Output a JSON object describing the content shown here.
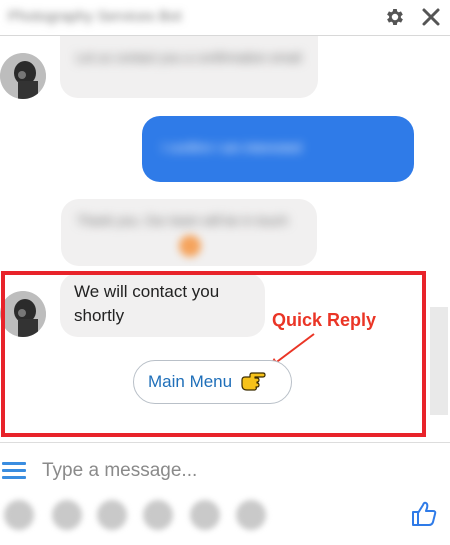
{
  "header": {
    "title": "Photography Services Bot",
    "settings_icon": "gear-icon",
    "close_icon": "close-icon"
  },
  "messages": {
    "bot_message_1": "Let us contact you a confirmation email",
    "user_message": "I confirm I am interested",
    "bot_message_2": "Thank you. Our team will be in touch",
    "bot_message_3": "We will contact you shortly"
  },
  "quick_reply": {
    "label": "Main Menu",
    "emoji_icon": "pointing-hand-icon"
  },
  "annotation": {
    "label": "Quick Reply",
    "color": "#ea3526"
  },
  "composer": {
    "placeholder": "Type a message...",
    "menu_icon": "menu-icon",
    "like_icon": "thumbs-up-icon"
  },
  "colors": {
    "accent": "#2f7be8",
    "bot_bubble": "#f1f0f0",
    "highlight_border": "#e8232a",
    "link": "#1f6fb9"
  }
}
